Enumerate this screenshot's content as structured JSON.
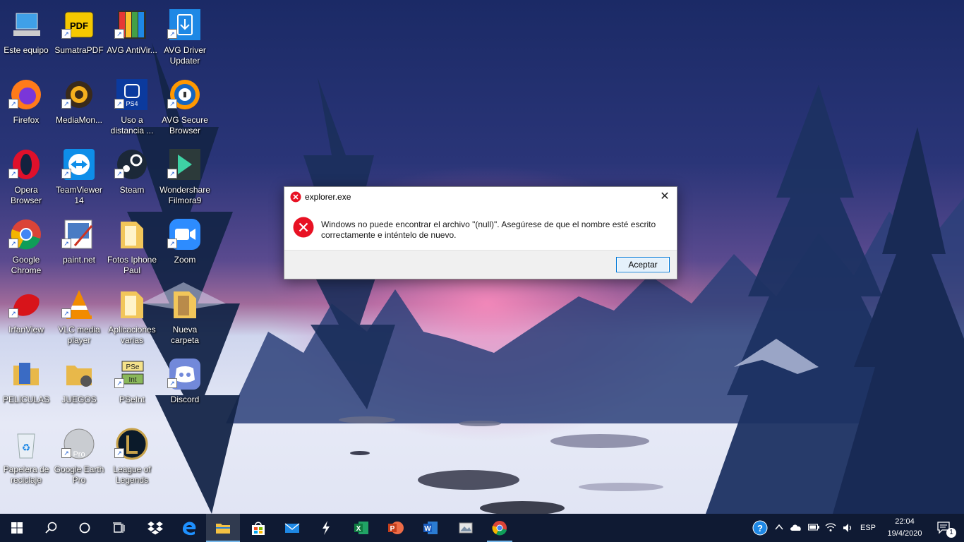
{
  "desktop": {
    "icons": [
      {
        "label": "Este equipo"
      },
      {
        "label": "SumatraPDF"
      },
      {
        "label": "AVG AntiVir..."
      },
      {
        "label": "AVG Driver Updater"
      },
      {
        "label": "Firefox"
      },
      {
        "label": "MediaMon..."
      },
      {
        "label": "Uso a distancia ..."
      },
      {
        "label": "AVG Secure Browser"
      },
      {
        "label": "Opera Browser"
      },
      {
        "label": "TeamViewer 14"
      },
      {
        "label": "Steam"
      },
      {
        "label": "Wondershare Filmora9"
      },
      {
        "label": "Google Chrome"
      },
      {
        "label": "paint.net"
      },
      {
        "label": "Fotos Iphone Paul"
      },
      {
        "label": "Zoom"
      },
      {
        "label": "IrfanView"
      },
      {
        "label": "VLC media player"
      },
      {
        "label": "Aplicaciones varias"
      },
      {
        "label": "Nueva carpeta"
      },
      {
        "label": "PELICULAS"
      },
      {
        "label": "JUEGOS"
      },
      {
        "label": "PSeInt"
      },
      {
        "label": "Discord"
      },
      {
        "label": "Papelera de reciclaje"
      },
      {
        "label": "Google Earth Pro"
      },
      {
        "label": "League of Legends"
      }
    ],
    "icon_badges": {
      "sumatra": "PDF",
      "ps4": "PS4",
      "pseint_top": "PSe",
      "pseint_bottom": "Int",
      "earth": "Pro"
    }
  },
  "dialog": {
    "title": "explorer.exe",
    "message": "Windows no puede encontrar el archivo \"(null)\". Asegúrese de que el nombre esté escrito correctamente e inténtelo de nuevo.",
    "ok_label": "Aceptar",
    "close_glyph": "✕"
  },
  "taskbar": {
    "language": "ESP",
    "time": "22:04",
    "date": "19/4/2020",
    "notification_count": "1"
  },
  "colors": {
    "error_red": "#e81123",
    "accent": "#0078d7",
    "taskbar": "#0f1a33"
  }
}
